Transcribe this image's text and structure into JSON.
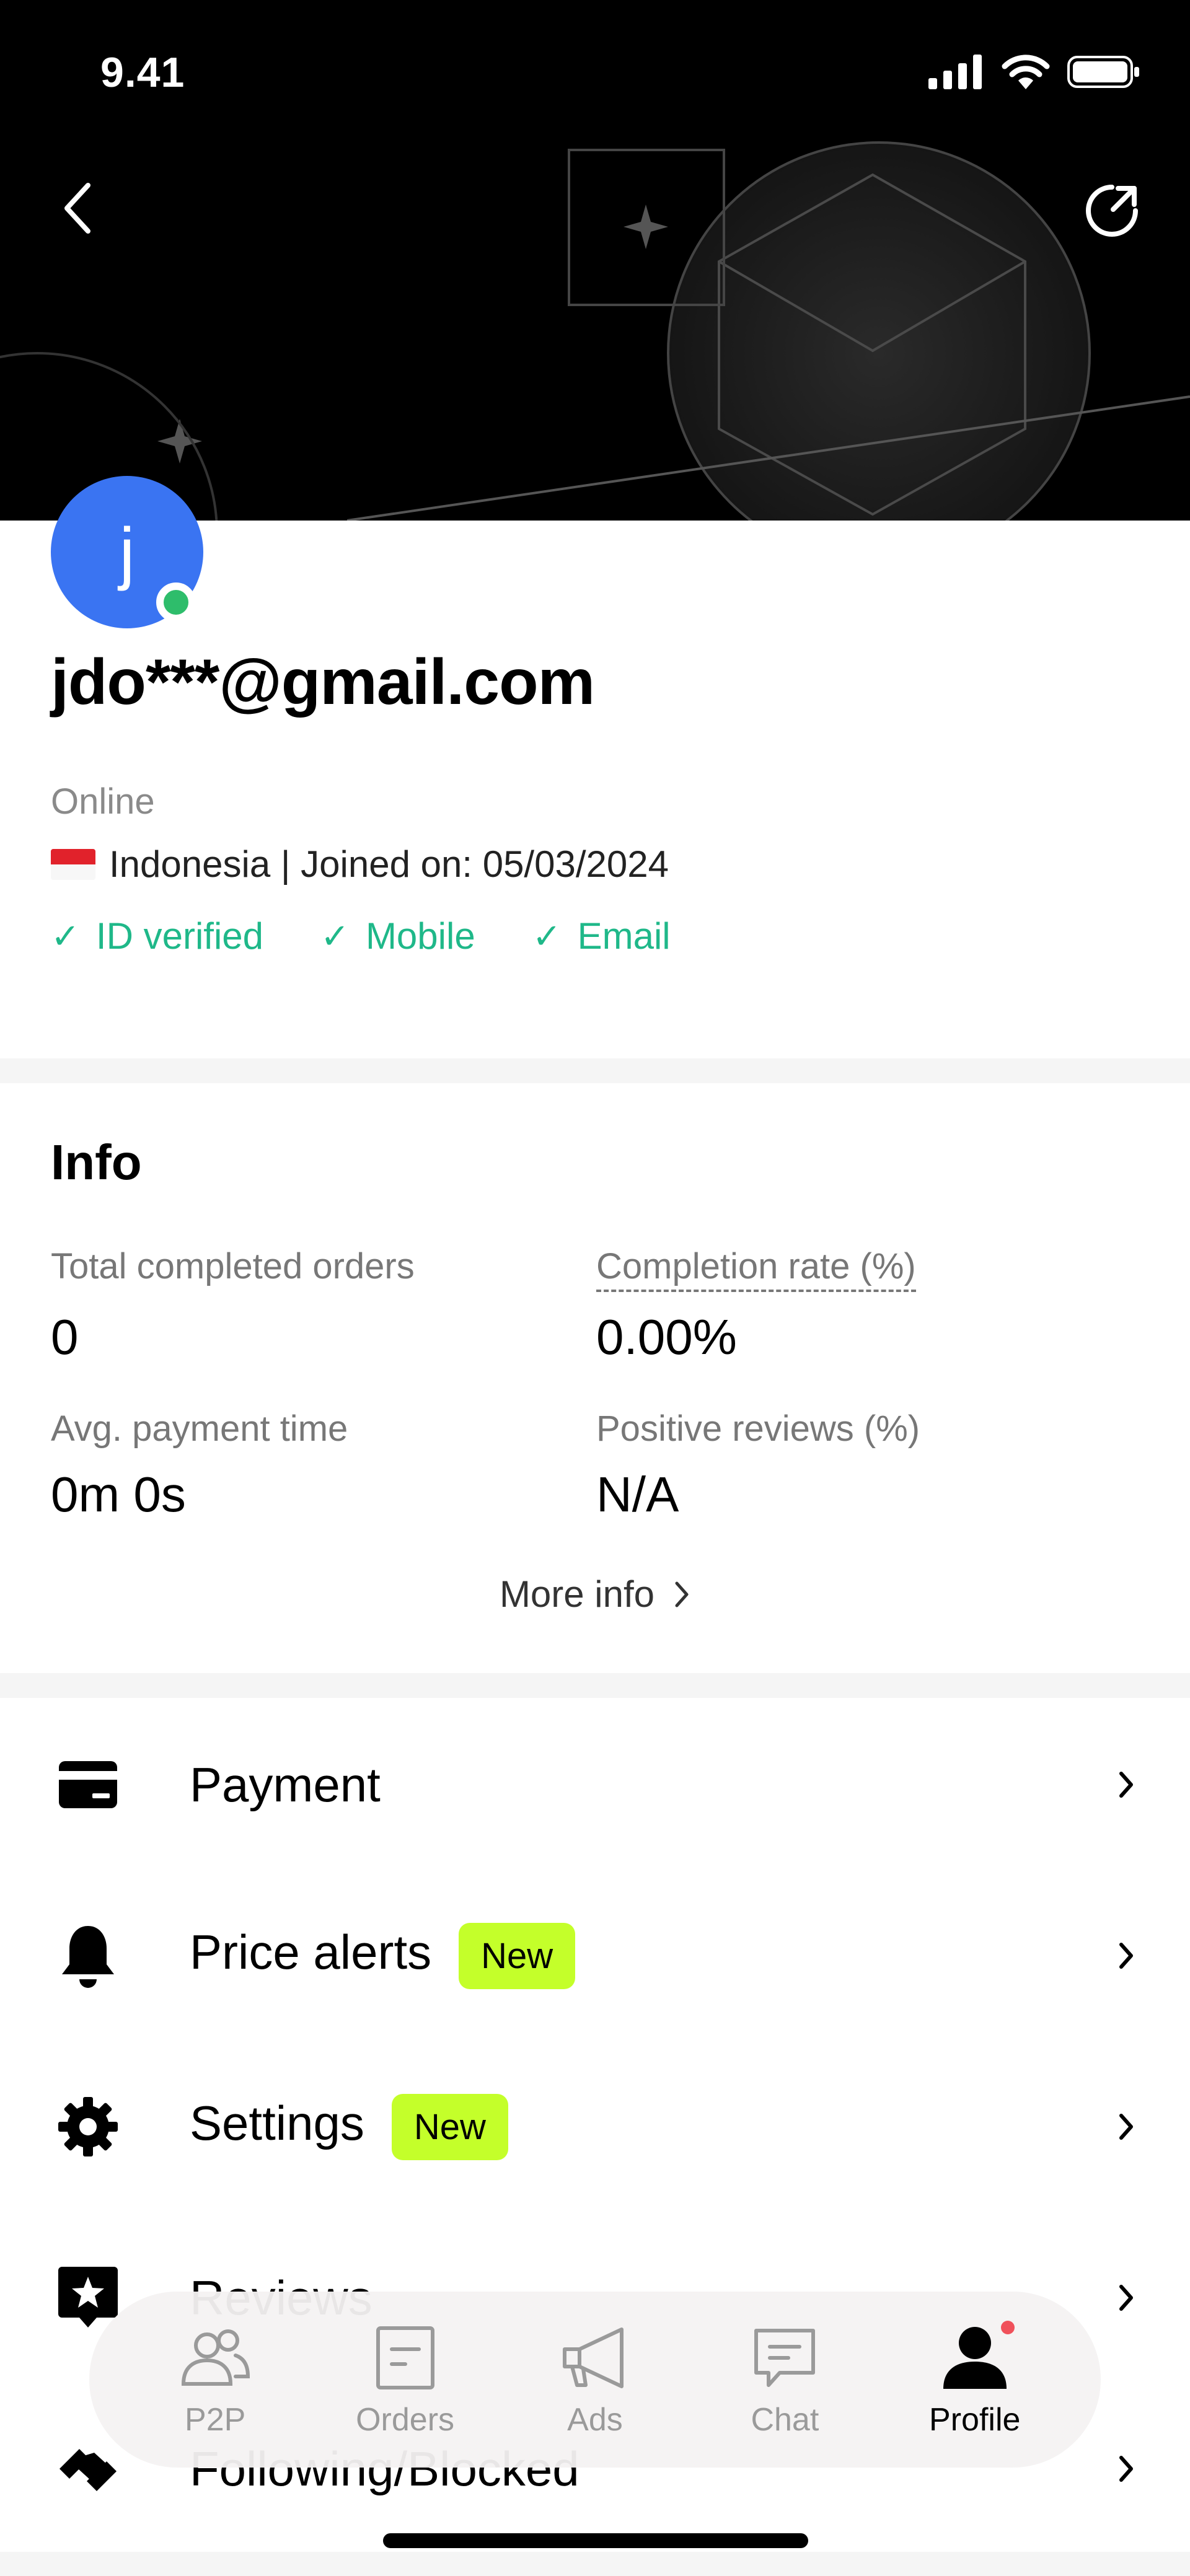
{
  "status_bar": {
    "time": "9.41"
  },
  "profile": {
    "avatar_letter": "j",
    "email": "jdo***@gmail.com",
    "status": "Online",
    "country_line": "Indonesia | Joined on: 05/03/2024",
    "verifications": [
      "ID verified",
      "Mobile",
      "Email"
    ]
  },
  "info": {
    "title": "Info",
    "stats": [
      {
        "label": "Total completed orders",
        "value": "0"
      },
      {
        "label": "Completion rate (%)",
        "value": "0.00%"
      },
      {
        "label": "Avg. payment time",
        "value": "0m 0s"
      },
      {
        "label": "Positive reviews (%)",
        "value": "N/A"
      }
    ],
    "more_info": "More info"
  },
  "menu": [
    {
      "label": "Payment",
      "badge": "",
      "icon": "card-icon"
    },
    {
      "label": "Price alerts",
      "badge": "New",
      "icon": "bell-icon"
    },
    {
      "label": "Settings",
      "badge": "New",
      "icon": "gear-icon"
    },
    {
      "label": "Reviews",
      "badge": "",
      "icon": "star-icon"
    },
    {
      "label": "Following/Blocked",
      "badge": "",
      "icon": "handshake-icon"
    }
  ],
  "tabbar": {
    "tabs": [
      {
        "label": "P2P",
        "icon": "people-icon"
      },
      {
        "label": "Orders",
        "icon": "document-icon"
      },
      {
        "label": "Ads",
        "icon": "megaphone-icon"
      },
      {
        "label": "Chat",
        "icon": "chat-icon"
      },
      {
        "label": "Profile",
        "icon": "person-icon"
      }
    ],
    "active": "Profile"
  },
  "colors": {
    "avatar": "#3a74f2",
    "online": "#2ebd6b",
    "verified": "#1fb889",
    "badge": "#c4ff2a"
  }
}
